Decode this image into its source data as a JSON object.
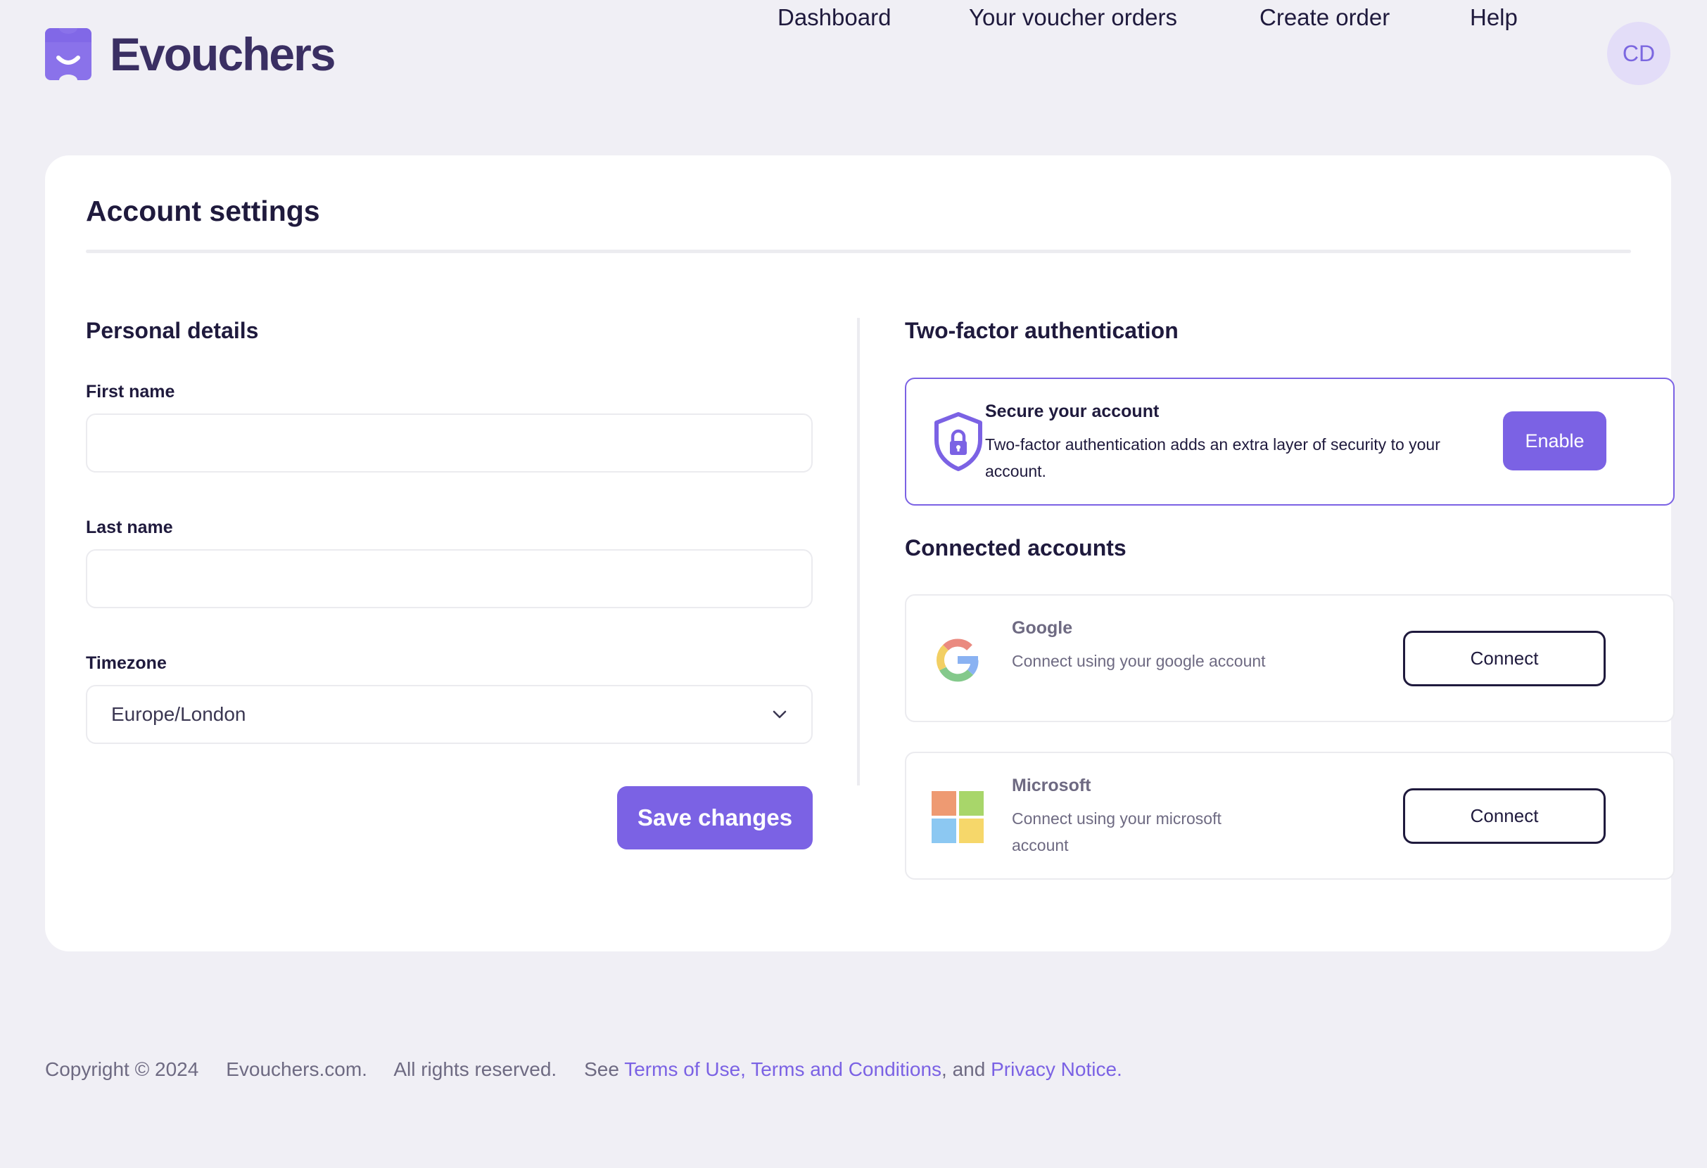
{
  "brand": {
    "name": "Evouchers",
    "accent": "#7b62e4"
  },
  "nav": {
    "items": [
      {
        "label": "Dashboard"
      },
      {
        "label": "Your voucher orders"
      },
      {
        "label": "Create order"
      },
      {
        "label": "Help"
      }
    ],
    "avatar_initials": "CD"
  },
  "page": {
    "title": "Account settings"
  },
  "personal_details": {
    "title": "Personal details",
    "first_name": {
      "label": "First name",
      "value": ""
    },
    "last_name": {
      "label": "Last name",
      "value": ""
    },
    "timezone": {
      "label": "Timezone",
      "selected": "Europe/London"
    },
    "save_label": "Save changes"
  },
  "two_factor": {
    "title": "Two-factor authentication",
    "heading": "Secure your account",
    "description": "Two-factor authentication adds an extra layer of security to your account.",
    "enable_label": "Enable",
    "icon": "shield-lock-icon"
  },
  "connected_accounts": {
    "title": "Connected accounts",
    "items": [
      {
        "name": "Google",
        "description": "Connect using your google account",
        "button_label": "Connect",
        "icon": "google-icon"
      },
      {
        "name": "Microsoft",
        "description": "Connect using your microsoft account",
        "button_label": "Connect",
        "icon": "microsoft-icon"
      }
    ]
  },
  "footer": {
    "copyright": "Copyright © 2024",
    "site": "Evouchers.com.",
    "rights": "All rights reserved.",
    "see": "See",
    "terms_of_use": "Terms of Use",
    "comma": ",",
    "terms_and_conditions": "Terms and Conditions",
    "and": ", and",
    "privacy_notice": "Privacy Notice",
    "period": "."
  }
}
